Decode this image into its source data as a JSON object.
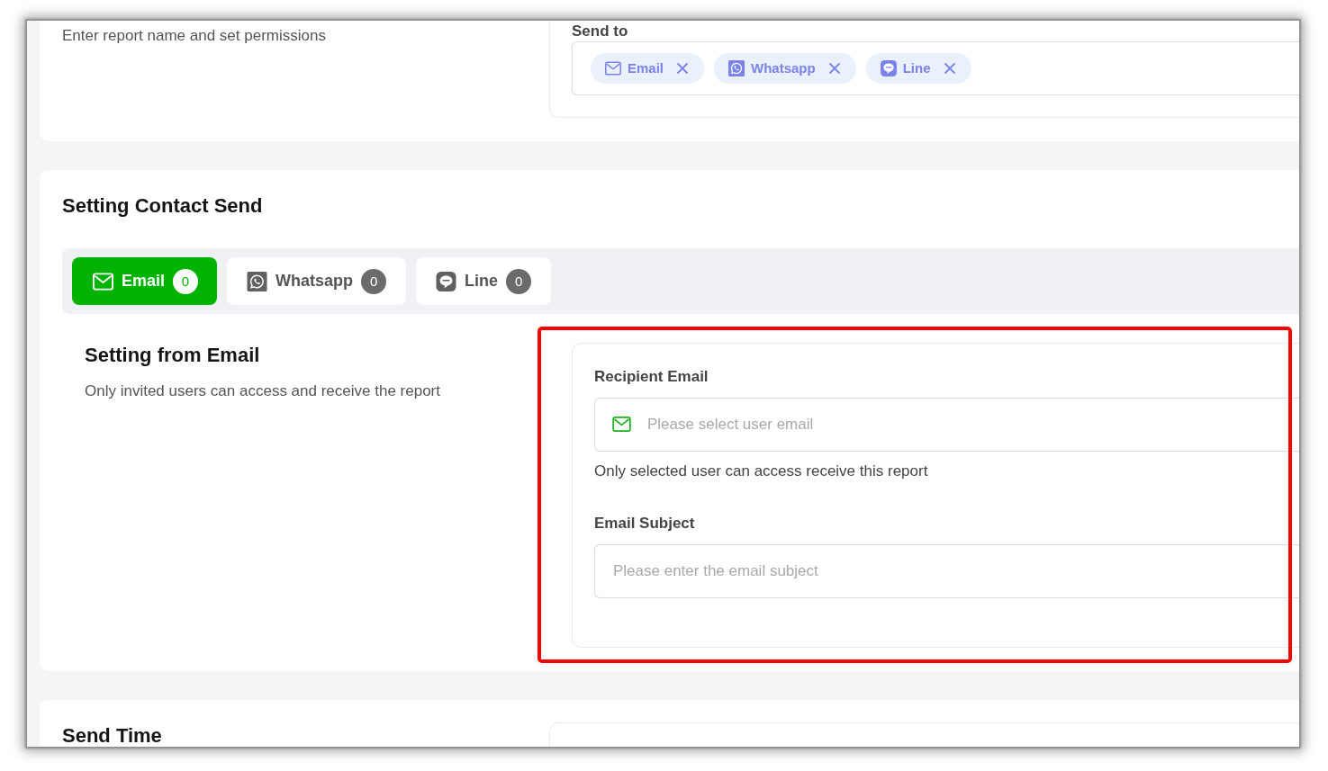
{
  "report_card": {
    "description": "Enter report name and set permissions",
    "send_to": {
      "label": "Send to",
      "tags": [
        {
          "kind": "email",
          "label": "Email"
        },
        {
          "kind": "whatsapp",
          "label": "Whatsapp"
        },
        {
          "kind": "line",
          "label": "Line"
        }
      ]
    }
  },
  "contact_card": {
    "title": "Setting Contact Send",
    "tabs": [
      {
        "kind": "email",
        "label": "Email",
        "count": "0",
        "selected": true
      },
      {
        "kind": "whatsapp",
        "label": "Whatsapp",
        "count": "0",
        "selected": false
      },
      {
        "kind": "line",
        "label": "Line",
        "count": "0",
        "selected": false
      }
    ],
    "section": {
      "title": "Setting from Email",
      "description": "Only invited users can access and receive the report",
      "fields": [
        {
          "kind": "email",
          "label": "Recipient Email",
          "placeholder": "Please select user email",
          "help": "Only selected user can access receive this report"
        },
        {
          "kind": "text",
          "label": "Email Subject",
          "placeholder": "Please enter the email subject"
        }
      ]
    }
  },
  "send_time_card": {
    "title": "Send Time"
  }
}
